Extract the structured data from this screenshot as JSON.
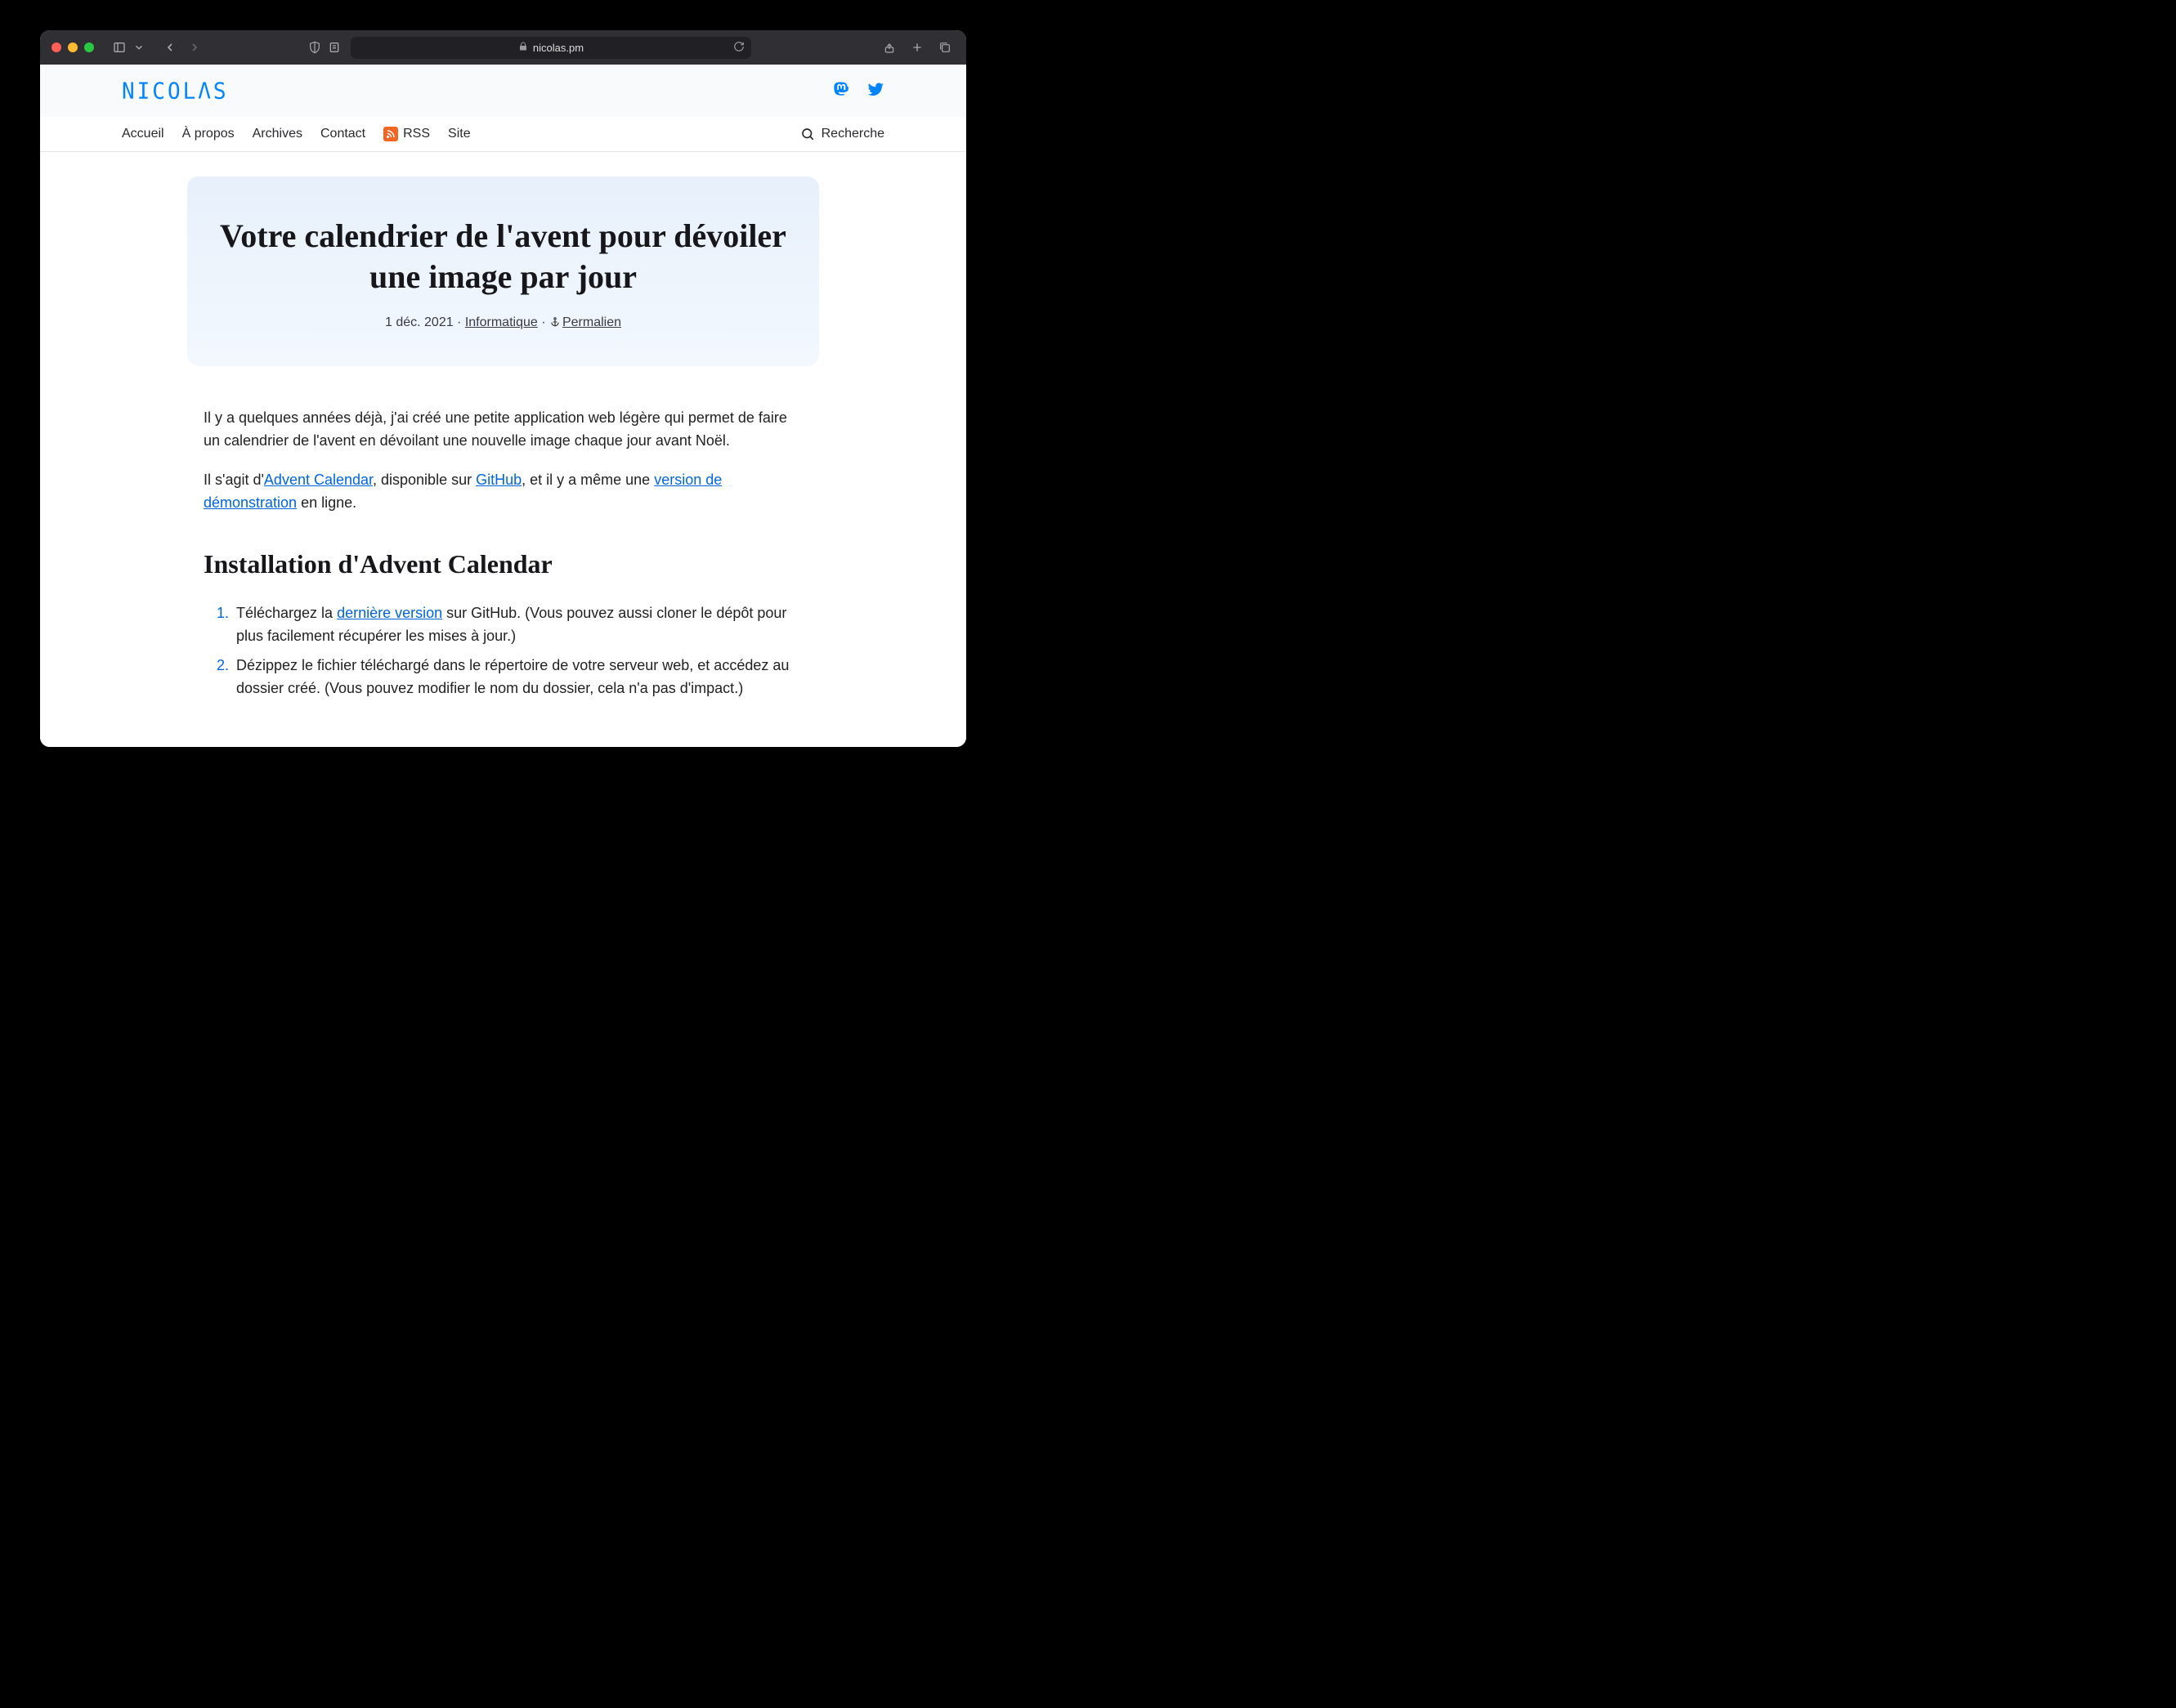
{
  "browser": {
    "url_host": "nicolas.pm"
  },
  "site": {
    "logo_text": "NICOLΛS",
    "nav": {
      "home": "Accueil",
      "about": "À propos",
      "archives": "Archives",
      "contact": "Contact",
      "rss": "RSS",
      "site": "Site",
      "search": "Recherche"
    }
  },
  "article": {
    "title": "Votre calendrier de l'avent pour dévoiler une image par jour",
    "date": "1 déc. 2021",
    "category": "Informatique",
    "permalink": "Permalien",
    "sep": " · ",
    "p1": "Il y a quelques années déjà, j'ai créé une petite application web légère qui permet de faire un calendrier de l'avent en dévoilant une nouvelle image chaque jour avant Noël.",
    "p2_a": "Il s'agit d'",
    "p2_link1": "Advent Calendar",
    "p2_b": ", disponible sur ",
    "p2_link2": "GitHub",
    "p2_c": ", et il y a même une ",
    "p2_link3": "version de démonstration",
    "p2_d": " en ligne.",
    "h2": "Installation d'Advent Calendar",
    "li1_a": "Téléchargez la ",
    "li1_link": "dernière version",
    "li1_b": " sur GitHub. (Vous pouvez aussi cloner le dépôt pour plus facilement récupérer les mises à jour.)",
    "li2": "Dézippez le fichier téléchargé dans le répertoire de votre serveur web, et accédez au dossier créé. (Vous pouvez modifier le nom du dossier, cela n'a pas d'impact.)"
  }
}
